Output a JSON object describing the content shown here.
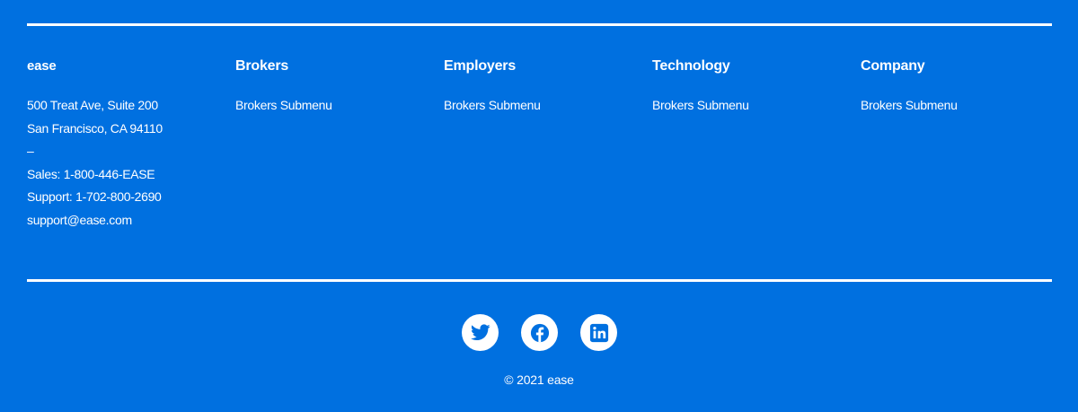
{
  "brand": {
    "name": "ease",
    "address_line1": "500 Treat Ave, Suite 200",
    "address_line2": "San Francisco, CA 94110",
    "separator": "–",
    "sales": "Sales: 1-800-446-EASE",
    "support": "Support: 1-702-800-2690",
    "email": "support@ease.com"
  },
  "columns": [
    {
      "title": "Brokers",
      "links": [
        "Brokers Submenu"
      ]
    },
    {
      "title": "Employers",
      "links": [
        "Brokers Submenu"
      ]
    },
    {
      "title": "Technology",
      "links": [
        "Brokers Submenu"
      ]
    },
    {
      "title": "Company",
      "links": [
        "Brokers Submenu"
      ]
    }
  ],
  "social": {
    "icons": [
      "twitter-icon",
      "facebook-icon",
      "linkedin-icon"
    ]
  },
  "copyright": "© 2021 ease",
  "colors": {
    "background": "#0070E0",
    "foreground": "#FFFFFF"
  }
}
